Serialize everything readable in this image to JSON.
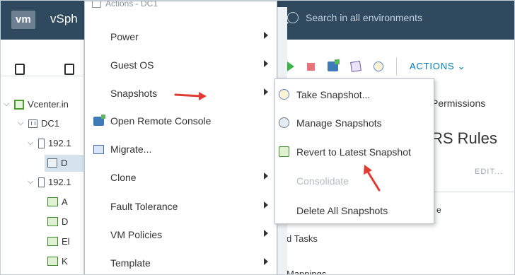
{
  "topbar": {
    "logo": "vm",
    "brand": "vSph",
    "search_placeholder": "Search in all environments"
  },
  "toolbar": {
    "actions_label": "ACTIONS ⌄"
  },
  "navigator": {
    "items": [
      {
        "label": "Vcenter.in"
      },
      {
        "label": "DC1"
      },
      {
        "label": "192.1"
      },
      {
        "label": "D"
      },
      {
        "label": "192.1"
      },
      {
        "label": "A"
      },
      {
        "label": "D"
      },
      {
        "label": "El"
      },
      {
        "label": "K"
      }
    ]
  },
  "content": {
    "permissions_tab": "Permissions",
    "section_title": "RS Rules",
    "edit_link": "EDIT...",
    "column_fragment": "e",
    "tasks_fragment": "d Tasks",
    "mappings_fragment": "Mappings"
  },
  "context_menu": {
    "header": "Actions - DC1",
    "items": [
      {
        "label": "Power",
        "has_submenu": true
      },
      {
        "label": "Guest OS",
        "has_submenu": true
      },
      {
        "label": "Snapshots",
        "has_submenu": true
      },
      {
        "label": "Open Remote Console",
        "has_submenu": false
      },
      {
        "label": "Migrate...",
        "has_submenu": false
      },
      {
        "label": "Clone",
        "has_submenu": true
      },
      {
        "label": "Fault Tolerance",
        "has_submenu": true
      },
      {
        "label": "VM Policies",
        "has_submenu": true
      },
      {
        "label": "Template",
        "has_submenu": true
      }
    ]
  },
  "snapshots_submenu": {
    "items": [
      {
        "label": "Take Snapshot...",
        "enabled": true
      },
      {
        "label": "Manage Snapshots",
        "enabled": true
      },
      {
        "label": "Revert to Latest Snapshot",
        "enabled": true
      },
      {
        "label": "Consolidate",
        "enabled": false
      },
      {
        "label": "Delete All Snapshots",
        "enabled": true
      }
    ]
  },
  "colors": {
    "topbar": "#2f4a5e",
    "accent_link": "#0079b8",
    "annotation_red": "#e03c31"
  }
}
